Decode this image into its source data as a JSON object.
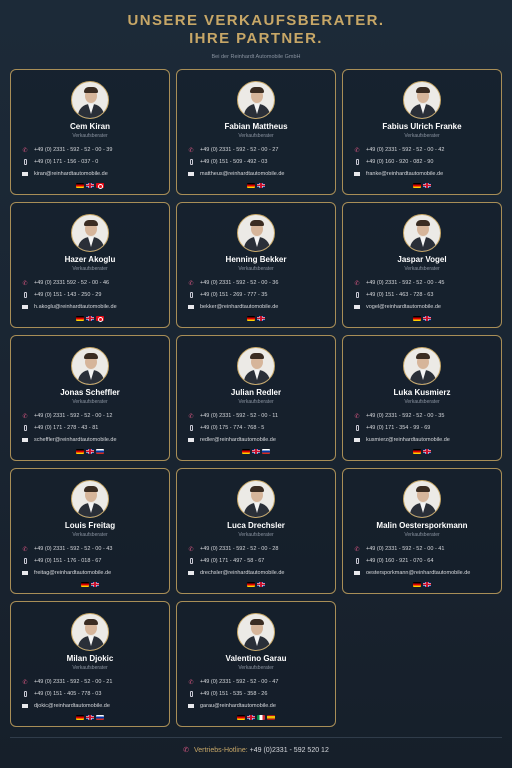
{
  "header": {
    "title_line1": "UNSERE VERKAUFSBERATER.",
    "title_line2": "IHRE PARTNER.",
    "subtitle": "Bei der Reinhardt Automobile GmbH"
  },
  "advisors": [
    {
      "name": "Cem Kiran",
      "role": "Verkaufsberater",
      "phone": "+49 (0) 2331 - 592 - 52 - 00 - 39",
      "mobile": "+49 (0) 171 - 156 - 037 - 0",
      "email": "kiran@reinhardtautomobile.de",
      "flags": [
        "de",
        "gb",
        "tr"
      ]
    },
    {
      "name": "Fabian Mattheus",
      "role": "Verkaufsberater",
      "phone": "+49 (0) 2331 - 592 - 52 - 00 - 27",
      "mobile": "+49 (0) 151 - 509 - 492 - 03",
      "email": "mattheus@reinhardtautomobile.de",
      "flags": [
        "de",
        "gb"
      ]
    },
    {
      "name": "Fabius Ulrich Franke",
      "role": "Verkaufsberater",
      "phone": "+49 (0) 2331 - 592 - 52 - 00 - 42",
      "mobile": "+49 (0) 160 - 920 - 082 - 90",
      "email": "franke@reinhardtautomobile.de",
      "flags": [
        "de",
        "gb"
      ]
    },
    {
      "name": "Hazer Akoglu",
      "role": "Verkaufsberater",
      "phone": "+49 (0) 2331 592 - 52 - 00 - 46",
      "mobile": "+49 (0) 151 - 143 - 250 - 29",
      "email": "h.akoglu@reinhardtautomobile.de",
      "flags": [
        "de",
        "gb",
        "tr"
      ]
    },
    {
      "name": "Henning Bekker",
      "role": "Verkaufsberater",
      "phone": "+49 (0) 2331 - 592 - 52 - 00 - 36",
      "mobile": "+49 (0) 151 - 269 - 777 - 35",
      "email": "bekker@reinhardtautomobile.de",
      "flags": [
        "de",
        "gb"
      ]
    },
    {
      "name": "Jaspar Vogel",
      "role": "Verkaufsberater",
      "phone": "+49 (0) 2331 - 592 - 52 - 00 - 45",
      "mobile": "+49 (0) 151 - 463 - 728 - 63",
      "email": "vogel@reinhardtautomobile.de",
      "flags": [
        "de",
        "gb"
      ]
    },
    {
      "name": "Jonas Scheffler",
      "role": "Verkaufsberater",
      "phone": "+49 (0) 2331 - 592 - 52 - 00 - 12",
      "mobile": "+49 (0) 171 - 278 - 43 - 81",
      "email": "scheffler@reinhardtautomobile.de",
      "flags": [
        "de",
        "gb",
        "ru"
      ]
    },
    {
      "name": "Julian Redler",
      "role": "Verkaufsberater",
      "phone": "+49 (0) 2331 - 592 - 52 - 00 - 11",
      "mobile": "+49 (0) 175 - 774 - 768 - 5",
      "email": "redler@reinhardtautomobile.de",
      "flags": [
        "de",
        "gb",
        "ru"
      ]
    },
    {
      "name": "Luka Kusmierz",
      "role": "Verkaufsberater",
      "phone": "+49 (0) 2331 - 592 - 52 - 00 - 35",
      "mobile": "+49 (0) 171 - 354 - 99 - 69",
      "email": "kusmierz@reinhardtautomobile.de",
      "flags": [
        "de",
        "gb"
      ]
    },
    {
      "name": "Louis Freitag",
      "role": "Verkaufsberater",
      "phone": "+49 (0) 2331 - 592 - 52 - 00 - 43",
      "mobile": "+49 (0) 151 - 176 - 018 - 67",
      "email": "freitag@reinhardtautomobile.de",
      "flags": [
        "de",
        "gb"
      ]
    },
    {
      "name": "Luca Drechsler",
      "role": "Verkaufsberater",
      "phone": "+49 (0) 2331 - 592 - 52 - 00 - 28",
      "mobile": "+49 (0) 171 - 497 - 58 - 67",
      "email": "drechsler@reinhardtautomobile.de",
      "flags": [
        "de",
        "gb"
      ]
    },
    {
      "name": "Malin Oestersporkmann",
      "role": "Verkaufsberater",
      "phone": "+49 (0) 2331 - 592 - 52 - 00 - 41",
      "mobile": "+49 (0) 160 - 921 - 070 - 64",
      "email": "oestersporkmann@reinhardtautomobile.de",
      "flags": [
        "de",
        "gb"
      ]
    },
    {
      "name": "Milan Djokic",
      "role": "Verkaufsberater",
      "phone": "+49 (0) 2331 - 592 - 52 - 00 - 21",
      "mobile": "+49 (0) 151 - 405 - 778 - 03",
      "email": "djokic@reinhardtautomobile.de",
      "flags": [
        "de",
        "gb",
        "ru"
      ]
    },
    {
      "name": "Valentino Garau",
      "role": "Verkaufsberater",
      "phone": "+49 (0) 2331 - 592 - 52 - 00 - 47",
      "mobile": "+49 (0) 151 - 535 - 358 - 26",
      "email": "garau@reinhardtautomobile.de",
      "flags": [
        "de",
        "gb",
        "it",
        "es"
      ]
    }
  ],
  "footer": {
    "hotline_label": "Vertriebs-Hotline:",
    "hotline_number": "+49 (0)2331 - 592 520 12"
  },
  "icons": {
    "phone": "phone-icon",
    "mobile": "mobile-icon",
    "email": "mail-icon"
  },
  "colors": {
    "accent_gold": "#c7a767",
    "phone_pink": "#d2557f",
    "background": "#1c2a38"
  }
}
